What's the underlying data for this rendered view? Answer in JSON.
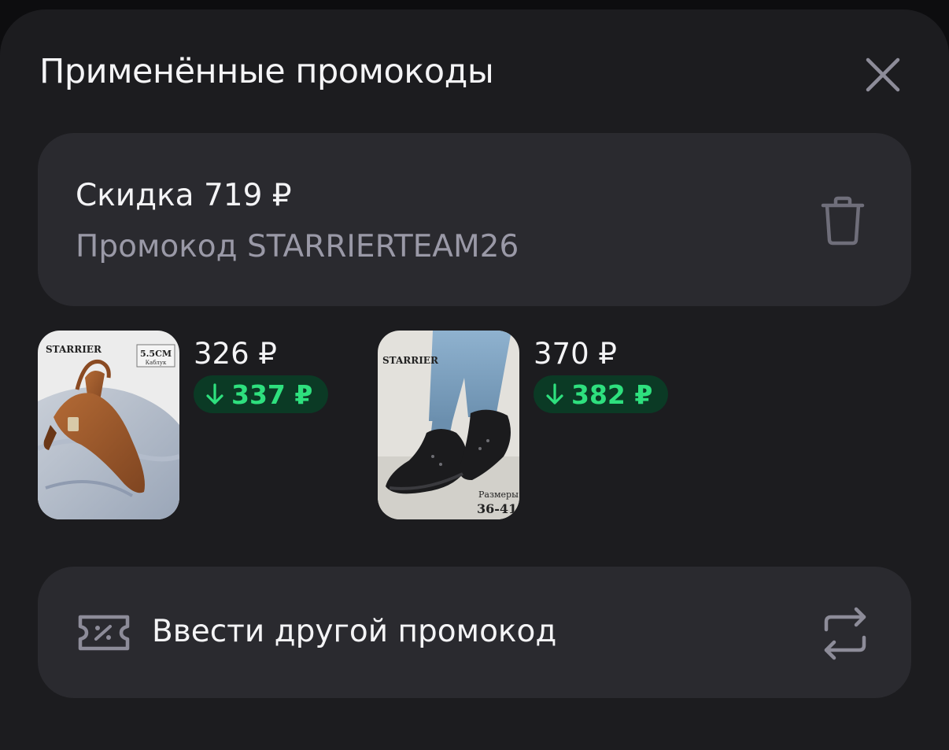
{
  "sheet": {
    "title": "Применённые промокоды",
    "close_icon": "close-icon"
  },
  "applied_promo": {
    "discount": "Скидка 719 ₽",
    "code": "Промокод STARRIERTEAM26",
    "delete_icon": "trash-icon"
  },
  "products": [
    {
      "price": "326 ₽",
      "old_price": "337 ₽",
      "image": {
        "brand": "STARRIER",
        "badge_main": "5.5CM",
        "badge_sub": "Каблук"
      }
    },
    {
      "price": "370 ₽",
      "old_price": "382 ₽",
      "image": {
        "brand": "STARRIER",
        "sizes_label": "Размеры",
        "sizes_value": "36-41"
      }
    }
  ],
  "enter_promo": {
    "label": "Ввести другой промокод",
    "ticket_icon": "promo-ticket-icon",
    "swap_icon": "swap-arrows-icon"
  },
  "colors": {
    "background": "#1c1c1f",
    "card": "#2a2a2f",
    "discount_green": "#2ee07e",
    "discount_badge_bg": "#0b3a25",
    "secondary_text": "#9a99a7"
  }
}
